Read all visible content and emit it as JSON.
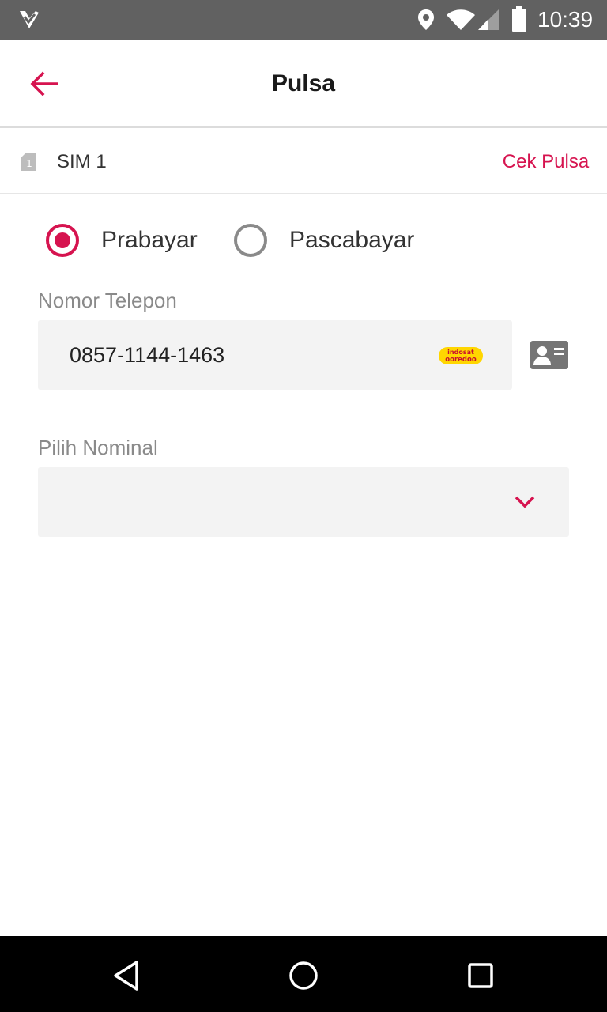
{
  "status_bar": {
    "time": "10:39",
    "icons": [
      "app-notification-icon",
      "location-icon",
      "wifi-icon",
      "signal-icon",
      "battery-icon"
    ]
  },
  "header": {
    "title": "Pulsa",
    "back_icon": "arrow-left-icon"
  },
  "sim": {
    "icon": "sim-card-icon",
    "label": "SIM 1",
    "check_balance_label": "Cek Pulsa"
  },
  "payment_type": {
    "options": [
      {
        "label": "Prabayar",
        "selected": true
      },
      {
        "label": "Pascabayar",
        "selected": false
      }
    ]
  },
  "phone": {
    "label": "Nomor Telepon",
    "value": "0857-1144-1463",
    "operator_logo": {
      "line1": "indosat",
      "line2": "ooredoo"
    },
    "contacts_icon": "contact-card-icon"
  },
  "nominal": {
    "label": "Pilih Nominal",
    "value": "",
    "icon": "chevron-down-icon"
  },
  "colors": {
    "accent": "#d6134f",
    "status_bar": "#616161",
    "field_bg": "#f3f3f3",
    "nav_bar": "#000000"
  },
  "nav_bar": {
    "icons": [
      "back-triangle-icon",
      "home-circle-icon",
      "recent-apps-square-icon"
    ]
  }
}
